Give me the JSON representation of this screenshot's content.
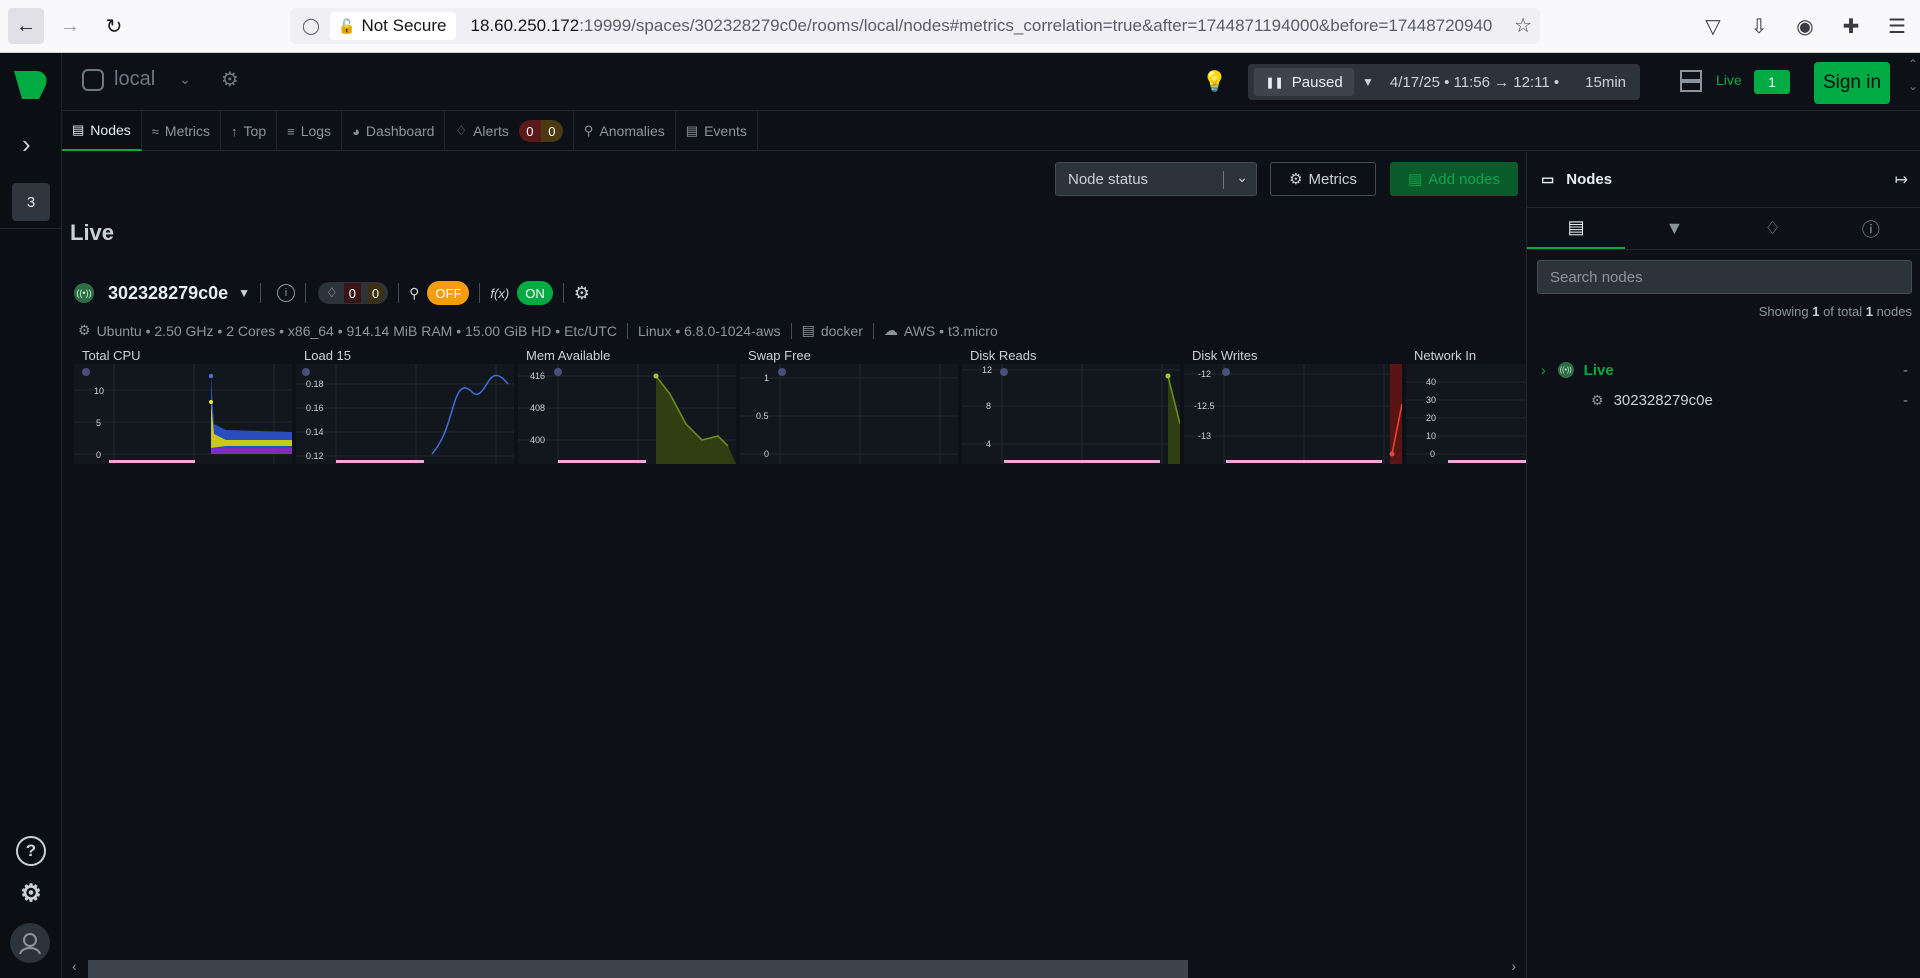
{
  "browser": {
    "not_secure": "Not Secure",
    "url_host": "18.60.250.172",
    "url_rest": ":19999/spaces/302328279c0e/rooms/local/nodes#metrics_correlation=true&after=1744871194000&before=17448720940"
  },
  "sidebar": {
    "space_badge": "3"
  },
  "header": {
    "room_name": "local",
    "play_state": "Paused",
    "time_range": "4/17/25 • 11:56 → 12:11 •",
    "duration": "15min",
    "live_label": "Live",
    "live_count": "1",
    "signin_label": "Sign in"
  },
  "tabs": [
    {
      "label": "Nodes",
      "icon": "nodes-icon"
    },
    {
      "label": "Metrics",
      "icon": "metrics-icon"
    },
    {
      "label": "Top",
      "icon": "top-icon"
    },
    {
      "label": "Logs",
      "icon": "logs-icon"
    },
    {
      "label": "Dashboard",
      "icon": "dashboard-icon"
    },
    {
      "label": "Alerts",
      "icon": "bell-icon",
      "critical": "0",
      "warning": "0"
    },
    {
      "label": "Anomalies",
      "icon": "anomalies-icon"
    },
    {
      "label": "Events",
      "icon": "events-icon"
    }
  ],
  "toolbar": {
    "node_status": "Node status",
    "metrics_label": "Metrics",
    "add_nodes_label": "Add nodes"
  },
  "main": {
    "title": "Live",
    "node": {
      "name": "302328279c0e",
      "alerts_critical": "0",
      "alerts_warning": "0",
      "ml_toggle": "OFF",
      "fx_toggle": "ON",
      "os_info": "Ubuntu • 2.50 GHz • 2 Cores • x86_64 • 914.14 MiB RAM • 15.00 GiB HD • Etc/UTC",
      "kernel_info": "Linux • 6.8.0-1024-aws",
      "container_info": "docker",
      "cloud_info": "AWS • t3.micro"
    },
    "charts": [
      {
        "title": "Total CPU",
        "ticks": [
          "10",
          "5",
          "0"
        ]
      },
      {
        "title": "Load 15",
        "ticks": [
          "0.18",
          "0.16",
          "0.14",
          "0.12"
        ]
      },
      {
        "title": "Mem Available",
        "ticks": [
          "416",
          "408",
          "400"
        ]
      },
      {
        "title": "Swap Free",
        "ticks": [
          "1",
          "0.5",
          "0"
        ]
      },
      {
        "title": "Disk Reads",
        "ticks": [
          "12",
          "8",
          "4"
        ]
      },
      {
        "title": "Disk Writes",
        "ticks": [
          "-12",
          "-12.5",
          "-13"
        ]
      },
      {
        "title": "Network In",
        "ticks": [
          "40",
          "30",
          "20",
          "10",
          "0"
        ]
      }
    ]
  },
  "right_panel": {
    "title": "Nodes",
    "search_placeholder": "Search nodes",
    "showing_pre": "Showing ",
    "showing_num": "1",
    "showing_mid": " of total ",
    "showing_total": "1",
    "showing_post": " nodes",
    "group_label": "Live",
    "group_value": "-",
    "node_label": "302328279c0e",
    "node_value": "-"
  },
  "colors": {
    "accent": "#00ab44",
    "off_toggle": "#f59e0b",
    "background": "#0d1117"
  }
}
